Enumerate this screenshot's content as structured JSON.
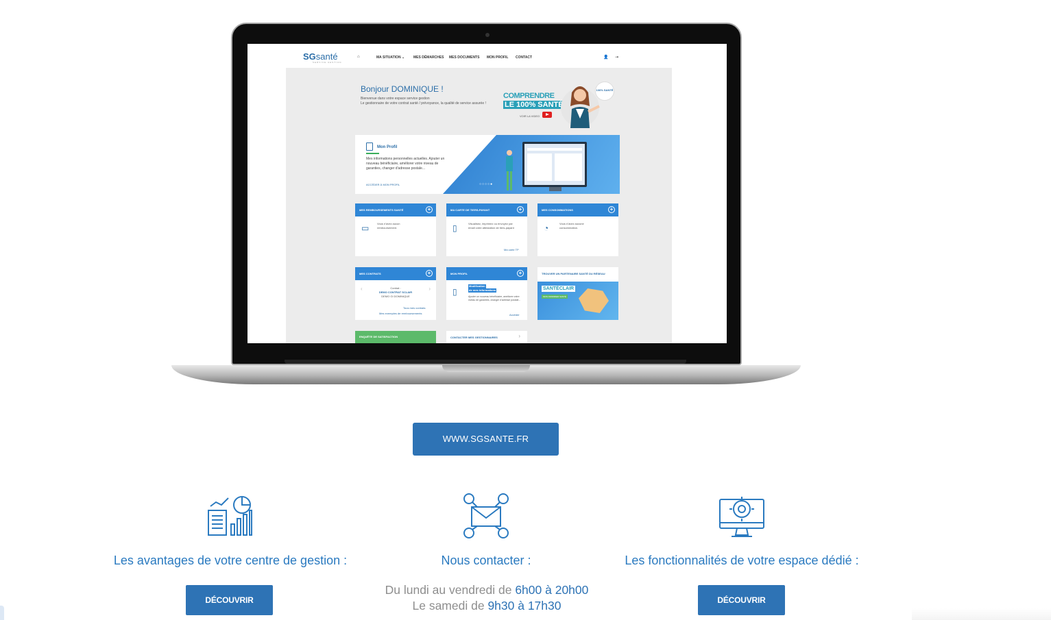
{
  "laptop_screen": {
    "logo": {
      "brand_a": "SG",
      "brand_b": "santé",
      "tagline": "SERVICE GESTION"
    },
    "nav": {
      "home_icon": "home-icon",
      "items": [
        "MA SITUATION ⌄",
        "MES DÉMARCHES",
        "MES DOCUMENTS",
        "MON PROFIL",
        "CONTACT"
      ],
      "user_icon": "user-icon",
      "logout_icon": "logout-icon"
    },
    "welcome": {
      "title": "Bonjour DOMINIQUE !",
      "line1": "Bienvenue dans votre espace service gestion",
      "line2": "Le gestionnaire de votre contrat santé / prévoyance, la qualité de service assurée !"
    },
    "promo": {
      "line1": "COMPRENDRE",
      "line2": "LE 100% SANTÉ",
      "cta": "VOIR LA VIDEO",
      "badge": "100% SANTÉ"
    },
    "hero": {
      "title": "Mon Profil",
      "text": "Mes informations personnelles actuelles. Ajouter un nouveau bénéficiaire, améliorer votre niveau de garanties, changer d'adresse postale...",
      "link": "ACCÉDER À MON PROFIL",
      "dots": "○○○○●"
    },
    "cards": {
      "remb": {
        "title": "MES REMBOURSEMENTS SANTÉ",
        "text": "Vous n'avez aucun remboursement."
      },
      "tp": {
        "title": "MA CARTE DE TIERS-PAYANT",
        "text": "Visualisez, imprimez ou envoyez par email votre attestation de tiers-payant",
        "link": "Ma carte TP"
      },
      "conso": {
        "title": "MES CONSOMMATIONS",
        "text": "Vous n'avez aucune consommation."
      },
      "contrats": {
        "title": "MES CONTRATS",
        "l1": "Contrat :",
        "l2": "DEMO CONTRAT SCLAIR",
        "l3": "DEMO GI DOMINIQUE",
        "link1": "Tous mes contrats",
        "link2": "Mes exemples de remboursements"
      },
      "profil": {
        "title": "MON PROFIL",
        "hl1": "Modification",
        "hl2": "de mes informations",
        "text": "Ajouter un nouveau bénéficiaire, améliorer votre niveau de garanties, changer d'adresse postale...",
        "link": "Accéder"
      },
      "partenaire": {
        "title": "TROUVER UN PARTENAIRE SANTÉ DU RÉSEAU",
        "brand": "SANTÉCLAIR",
        "brand_sub": "MON INFIRMIER SANTÉ"
      },
      "enquete": {
        "title": "ENQUÊTE DE SATISFACTION"
      },
      "contact": {
        "title": "CONTACTER MES GESTIONNAIRES"
      }
    }
  },
  "url_button": "WWW.SGSANTE.FR",
  "features": [
    {
      "icon": "analytics-report-icon",
      "title": "Les avantages de votre centre de gestion :",
      "button": "DÉCOUVRIR"
    },
    {
      "icon": "email-network-icon",
      "title": "Nous contacter :"
    },
    {
      "icon": "monitor-settings-icon",
      "title": "Les fonctionnalités de votre espace dédié :",
      "button": "DÉCOUVRIR"
    }
  ],
  "hours": {
    "l1_prefix": "Du lundi au vendredi de ",
    "l1_time": "6h00 à 20h00",
    "l2_prefix": "Le samedi de ",
    "l2_time": "9h30 à 17h30"
  },
  "colors": {
    "primary": "#2e73b5",
    "accent_text": "#2a7ac0",
    "card_header": "#2f86d6",
    "green": "#5cba6a"
  }
}
